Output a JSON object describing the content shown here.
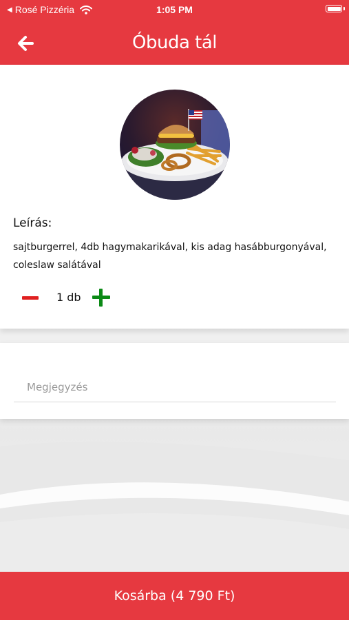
{
  "status_bar": {
    "back_app": "Rosé Pizzéria",
    "time": "1:05 PM"
  },
  "header": {
    "title": "Óbuda tál",
    "back_icon": "arrow-left-icon"
  },
  "product": {
    "image_icon": "burger-plate-photo",
    "description_label": "Leírás:",
    "description": "sajtburgerrel, 4db hagymakarikával, kis adag hasábburgonyával, coleslaw salátával"
  },
  "quantity": {
    "value": "1 db"
  },
  "note": {
    "placeholder": "Megjegyzés",
    "value": ""
  },
  "footer": {
    "cart_label": "Kosárba (4 790 Ft)"
  },
  "colors": {
    "primary": "#e63940",
    "minus": "#e02020",
    "plus": "#0b8a16"
  }
}
